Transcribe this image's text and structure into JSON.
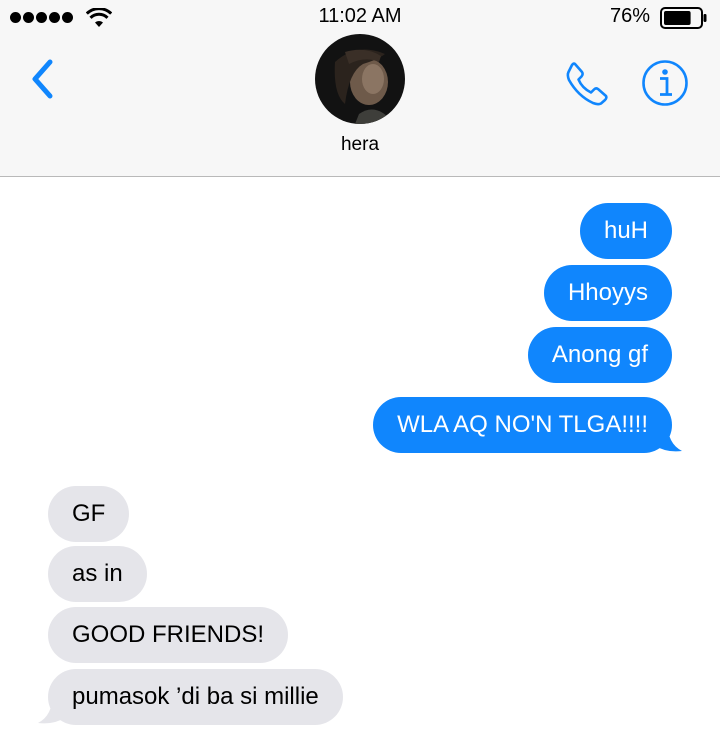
{
  "status_bar": {
    "time": "11:02 AM",
    "battery_percent": "76%",
    "battery_level": 0.76,
    "signal_bars": 5,
    "signal_icon": "signal-dots-icon",
    "wifi_icon": "wifi-icon",
    "battery_icon": "battery-icon"
  },
  "header": {
    "contact_name": "hera",
    "back_icon": "chevron-left-icon",
    "call_icon": "phone-icon",
    "info_icon": "info-icon",
    "accent_color": "#1086fd"
  },
  "messages": [
    {
      "direction": "sent",
      "text": "huH"
    },
    {
      "direction": "sent",
      "text": "Hhoyys"
    },
    {
      "direction": "sent",
      "text": "Anong gf"
    },
    {
      "direction": "sent",
      "text": "WLA AQ NO'N TLGA!!!!"
    },
    {
      "direction": "received",
      "text": "GF"
    },
    {
      "direction": "received",
      "text": "as in"
    },
    {
      "direction": "received",
      "text": "GOOD FRIENDS!"
    },
    {
      "direction": "received",
      "text": "pumasok ’di ba si millie"
    }
  ],
  "colors": {
    "sent_bubble": "#1086fd",
    "received_bubble": "#e5e5ea",
    "header_background": "#f7f7f7"
  }
}
